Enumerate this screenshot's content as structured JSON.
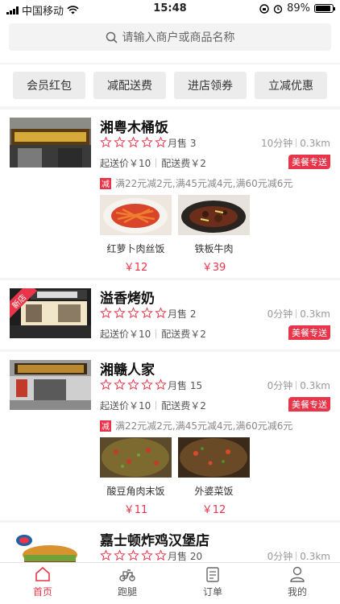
{
  "status_bar": {
    "carrier": "中国移动",
    "time": "15:48",
    "battery": "89%",
    "battery_level": 0.89
  },
  "search": {
    "placeholder": "请输入商户或商品名称"
  },
  "filters": [
    "会员红包",
    "减配送费",
    "进店领券",
    "立减优惠"
  ],
  "shops": [
    {
      "name": "湘粤木桶饭",
      "sales_label": "月售 3",
      "time": "10分钟",
      "distance": "0.3km",
      "min_order": "起送价￥10",
      "delivery_fee": "配送费￥2",
      "badge": "美餐专送",
      "promo_tag": "减",
      "promo": "满22元减2元,满45元减4元,满60元减6元",
      "dishes": [
        {
          "name": "红萝卜肉丝饭",
          "price": "￥12"
        },
        {
          "name": "铁板牛肉",
          "price": "￥39"
        }
      ]
    },
    {
      "name": "溢香烤奶",
      "ribbon": "新店",
      "sales_label": "月售 2",
      "time": "0分钟",
      "distance": "0.3km",
      "min_order": "起送价￥10",
      "delivery_fee": "配送费￥2",
      "badge": "美餐专送"
    },
    {
      "name": "湘赣人家",
      "sales_label": "月售 15",
      "time": "0分钟",
      "distance": "0.3km",
      "min_order": "起送价￥10",
      "delivery_fee": "配送费￥2",
      "badge": "美餐专送",
      "promo_tag": "减",
      "promo": "满22元减2元,满45元减4元,满60元减6元",
      "dishes": [
        {
          "name": "酸豆角肉末饭",
          "price": "￥11"
        },
        {
          "name": "外婆菜饭",
          "price": "￥12"
        }
      ]
    },
    {
      "name": "嘉士顿炸鸡汉堡店",
      "sales_label": "月售 20",
      "time": "0分钟",
      "distance": "0.3km"
    }
  ],
  "tabbar": [
    {
      "label": "首页",
      "icon": "home-icon"
    },
    {
      "label": "跑腿",
      "icon": "scooter-icon"
    },
    {
      "label": "订单",
      "icon": "order-icon"
    },
    {
      "label": "我的",
      "icon": "user-icon"
    }
  ],
  "colors": {
    "accent": "#e8354a",
    "star": "#e8354a"
  }
}
